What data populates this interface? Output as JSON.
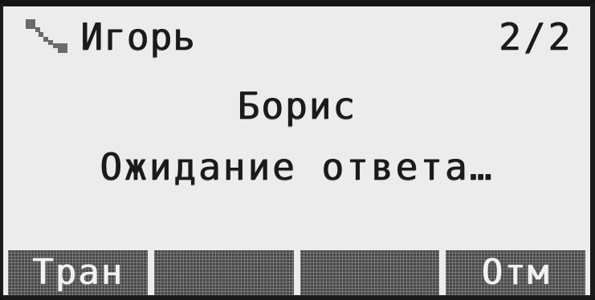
{
  "header": {
    "caller_name": "Игорь",
    "call_counter": "2/2",
    "icon": "phone-handset-icon"
  },
  "call": {
    "callee_name": "Борис",
    "status": "Ожидание ответа…"
  },
  "softkeys": [
    {
      "label": "Тран"
    },
    {
      "label": ""
    },
    {
      "label": ""
    },
    {
      "label": "Отм"
    }
  ],
  "colors": {
    "screen_background": "#ececec",
    "text": "#1b1b1b",
    "softkey_background": "#4a4a4a",
    "softkey_text": "#f2f2f2"
  }
}
